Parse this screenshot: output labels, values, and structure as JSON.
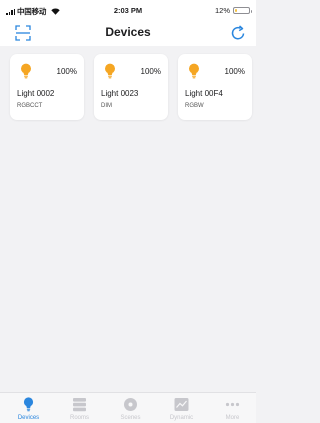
{
  "status_bar": {
    "carrier": "中国移动",
    "time": "2:03 PM",
    "battery_text": "12%",
    "battery_level": 0.12
  },
  "header": {
    "title": "Devices",
    "scan_icon": "scan-icon",
    "refresh_icon": "refresh-icon"
  },
  "devices": [
    {
      "name": "Light 0002",
      "type": "RGBCCT",
      "brightness": "100%",
      "icon": "bulb-icon"
    },
    {
      "name": "Light 0023",
      "type": "DIM",
      "brightness": "100%",
      "icon": "bulb-icon"
    },
    {
      "name": "Light 00F4",
      "type": "RGBW",
      "brightness": "100%",
      "icon": "bulb-icon"
    }
  ],
  "tabs": [
    {
      "label": "Devices",
      "icon": "bulb-icon",
      "active": true
    },
    {
      "label": "Rooms",
      "icon": "rooms-icon",
      "active": false
    },
    {
      "label": "Scenes",
      "icon": "scenes-icon",
      "active": false
    },
    {
      "label": "Dynamic",
      "icon": "dynamic-icon",
      "active": false
    },
    {
      "label": "More",
      "icon": "more-icon",
      "active": false
    }
  ],
  "colors": {
    "accent": "#2a86de",
    "bulb": "#f5a623",
    "inactive": "#c7c7cc",
    "background": "#f2f2f4"
  }
}
